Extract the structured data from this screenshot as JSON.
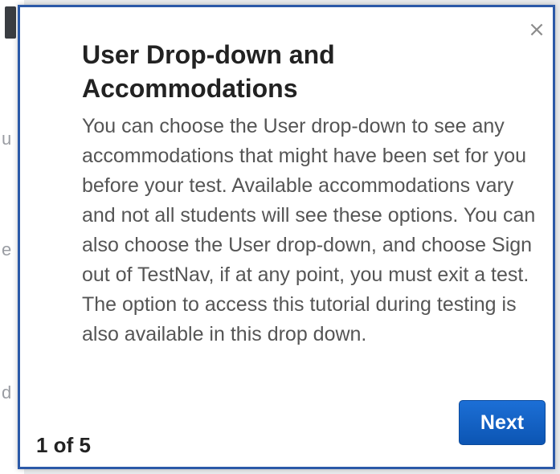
{
  "background": {
    "fragments": [
      "u",
      "e",
      "d"
    ]
  },
  "popup": {
    "close_label": "×",
    "title": "User Drop-down and Accommodations",
    "body": "You can choose the User drop-down to see any accommodations that might have been set for you before your test. Available accommodations vary and not all students will see these options. You can also choose the User drop-down, and choose Sign out of TestNav, if at any point, you must exit a test. The option to access this tutorial during testing is also available in this drop down.",
    "step_counter": "1 of 5",
    "next_label": "Next"
  },
  "colors": {
    "popup_border": "#2b59a8",
    "next_button": "#1260c4",
    "title_text": "#222222",
    "body_text": "#555555"
  },
  "icons": {
    "close": "close-icon"
  }
}
